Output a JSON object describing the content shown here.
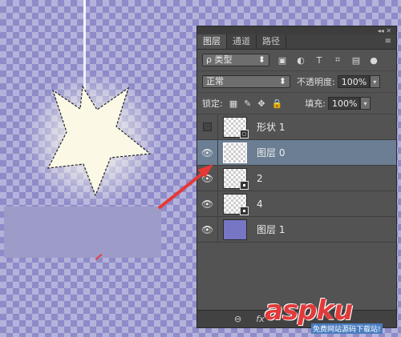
{
  "tabs": [
    "图层",
    "通道",
    "路径"
  ],
  "panel_top_controls": "◂◂ ✕",
  "panel_menu": "≡",
  "filter": {
    "label": "ρ 类型",
    "icons": [
      "image-filter-icon",
      "adjustment-filter-icon",
      "text-filter-icon",
      "shape-filter-icon",
      "smart-object-filter-icon"
    ]
  },
  "filter_glyphs": {
    "text": "T"
  },
  "blend": {
    "mode": "正常",
    "opacity_label": "不透明度:",
    "opacity": "100%"
  },
  "lock": {
    "label": "锁定:",
    "fill_label": "填充:",
    "fill": "100%"
  },
  "layers": [
    {
      "name": "形状 1",
      "visible": false,
      "selected": false,
      "thumb": "checker",
      "badge": "shape"
    },
    {
      "name": "图层 0",
      "visible": true,
      "selected": true,
      "thumb": "checker",
      "badge": ""
    },
    {
      "name": "2",
      "visible": true,
      "selected": false,
      "thumb": "checker",
      "badge": "smart"
    },
    {
      "name": "4",
      "visible": true,
      "selected": false,
      "thumb": "checker",
      "badge": "smart"
    },
    {
      "name": "图层 1",
      "visible": true,
      "selected": false,
      "thumb": "solid",
      "badge": ""
    }
  ],
  "bottom_icons": [
    "link-icon",
    "fx-icon"
  ],
  "bottom_labels": {
    "fx": "fx"
  },
  "watermark": {
    "brand": "aspku",
    "tagline": "免费网站源码下载站!"
  },
  "colors": {
    "panel_bg": "#535353",
    "selected_row": "#6b7e93",
    "arrow": "#e53935",
    "canvas_tint": "#9d9bc8"
  }
}
